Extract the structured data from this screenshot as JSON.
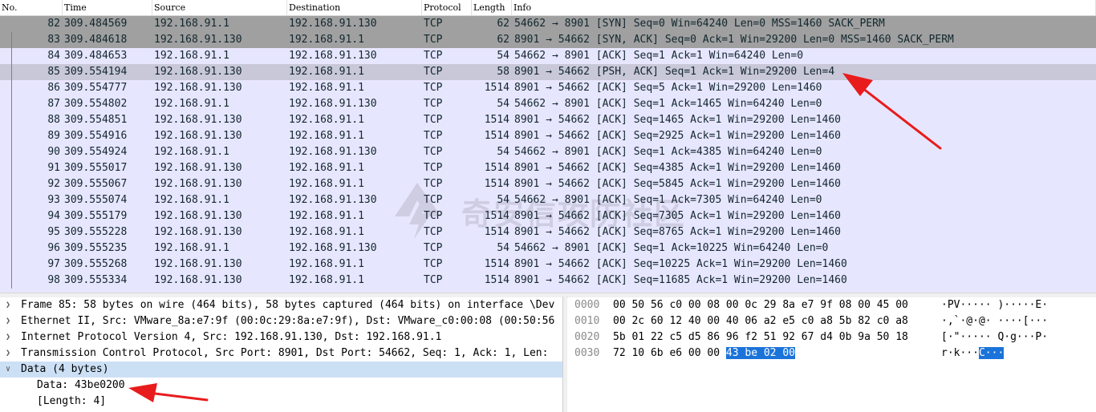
{
  "packet_list": {
    "columns": [
      "No.",
      "Time",
      "Source",
      "Destination",
      "Protocol",
      "Length",
      "Info"
    ],
    "rows": [
      {
        "no": "82",
        "time": "309.484569",
        "source": "192.168.91.1",
        "destination": "192.168.91.130",
        "protocol": "TCP",
        "length": "62",
        "info": "54662 → 8901 [SYN] Seq=0 Win=64240 Len=0 MSS=1460 SACK_PERM"
      },
      {
        "no": "83",
        "time": "309.484618",
        "source": "192.168.91.130",
        "destination": "192.168.91.1",
        "protocol": "TCP",
        "length": "62",
        "info": "8901 → 54662 [SYN, ACK] Seq=0 Ack=1 Win=29200 Len=0 MSS=1460 SACK_PERM"
      },
      {
        "no": "84",
        "time": "309.484653",
        "source": "192.168.91.1",
        "destination": "192.168.91.130",
        "protocol": "TCP",
        "length": "54",
        "info": "54662 → 8901 [ACK] Seq=1 Ack=1 Win=64240 Len=0"
      },
      {
        "no": "85",
        "time": "309.554194",
        "source": "192.168.91.130",
        "destination": "192.168.91.1",
        "protocol": "TCP",
        "length": "58",
        "info": "8901 → 54662 [PSH, ACK] Seq=1 Ack=1 Win=29200 Len=4"
      },
      {
        "no": "86",
        "time": "309.554777",
        "source": "192.168.91.130",
        "destination": "192.168.91.1",
        "protocol": "TCP",
        "length": "1514",
        "info": "8901 → 54662 [ACK] Seq=5 Ack=1 Win=29200 Len=1460"
      },
      {
        "no": "87",
        "time": "309.554802",
        "source": "192.168.91.1",
        "destination": "192.168.91.130",
        "protocol": "TCP",
        "length": "54",
        "info": "54662 → 8901 [ACK] Seq=1 Ack=1465 Win=64240 Len=0"
      },
      {
        "no": "88",
        "time": "309.554851",
        "source": "192.168.91.130",
        "destination": "192.168.91.1",
        "protocol": "TCP",
        "length": "1514",
        "info": "8901 → 54662 [ACK] Seq=1465 Ack=1 Win=29200 Len=1460"
      },
      {
        "no": "89",
        "time": "309.554916",
        "source": "192.168.91.130",
        "destination": "192.168.91.1",
        "protocol": "TCP",
        "length": "1514",
        "info": "8901 → 54662 [ACK] Seq=2925 Ack=1 Win=29200 Len=1460"
      },
      {
        "no": "90",
        "time": "309.554924",
        "source": "192.168.91.1",
        "destination": "192.168.91.130",
        "protocol": "TCP",
        "length": "54",
        "info": "54662 → 8901 [ACK] Seq=1 Ack=4385 Win=64240 Len=0"
      },
      {
        "no": "91",
        "time": "309.555017",
        "source": "192.168.91.130",
        "destination": "192.168.91.1",
        "protocol": "TCP",
        "length": "1514",
        "info": "8901 → 54662 [ACK] Seq=4385 Ack=1 Win=29200 Len=1460"
      },
      {
        "no": "92",
        "time": "309.555067",
        "source": "192.168.91.130",
        "destination": "192.168.91.1",
        "protocol": "TCP",
        "length": "1514",
        "info": "8901 → 54662 [ACK] Seq=5845 Ack=1 Win=29200 Len=1460"
      },
      {
        "no": "93",
        "time": "309.555074",
        "source": "192.168.91.1",
        "destination": "192.168.91.130",
        "protocol": "TCP",
        "length": "54",
        "info": "54662 → 8901 [ACK] Seq=1 Ack=7305 Win=64240 Len=0"
      },
      {
        "no": "94",
        "time": "309.555179",
        "source": "192.168.91.130",
        "destination": "192.168.91.1",
        "protocol": "TCP",
        "length": "1514",
        "info": "8901 → 54662 [ACK] Seq=7305 Ack=1 Win=29200 Len=1460"
      },
      {
        "no": "95",
        "time": "309.555228",
        "source": "192.168.91.130",
        "destination": "192.168.91.1",
        "protocol": "TCP",
        "length": "1514",
        "info": "8901 → 54662 [ACK] Seq=8765 Ack=1 Win=29200 Len=1460"
      },
      {
        "no": "96",
        "time": "309.555235",
        "source": "192.168.91.1",
        "destination": "192.168.91.130",
        "protocol": "TCP",
        "length": "54",
        "info": "54662 → 8901 [ACK] Seq=1 Ack=10225 Win=64240 Len=0"
      },
      {
        "no": "97",
        "time": "309.555268",
        "source": "192.168.91.130",
        "destination": "192.168.91.1",
        "protocol": "TCP",
        "length": "1514",
        "info": "8901 → 54662 [ACK] Seq=10225 Ack=1 Win=29200 Len=1460"
      },
      {
        "no": "98",
        "time": "309.555334",
        "source": "192.168.91.130",
        "destination": "192.168.91.1",
        "protocol": "TCP",
        "length": "1514",
        "info": "8901 → 54662 [ACK] Seq=11685 Ack=1 Win=29200 Len=1460"
      }
    ]
  },
  "details": {
    "lines": [
      {
        "expanded": false,
        "text": "Frame 85: 58 bytes on wire (464 bits), 58 bytes captured (464 bits) on interface \\Dev"
      },
      {
        "expanded": false,
        "text": "Ethernet II, Src: VMware_8a:e7:9f (00:0c:29:8a:e7:9f), Dst: VMware_c0:00:08 (00:50:56"
      },
      {
        "expanded": false,
        "text": "Internet Protocol Version 4, Src: 192.168.91.130, Dst: 192.168.91.1"
      },
      {
        "expanded": false,
        "text": "Transmission Control Protocol, Src Port: 8901, Dst Port: 54662, Seq: 1, Ack: 1, Len:"
      },
      {
        "expanded": true,
        "text": "Data (4 bytes)"
      }
    ],
    "children": [
      "Data: 43be0200",
      "[Length: 4]"
    ]
  },
  "bytes": {
    "rows": [
      {
        "offset": "0000",
        "hex": "00 50 56 c0 00 08 00 0c  29 8a e7 9f 08 00 45 00",
        "ascii": "·PV·····  )·····E·"
      },
      {
        "offset": "0010",
        "hex": "00 2c 60 12 40 00 40 06  a2 e5 c0 a8 5b 82 c0 a8",
        "ascii": "·,`·@·@·  ····[···"
      },
      {
        "offset": "0020",
        "hex": "5b 01 22 c5 d5 86 96 f2  51 92 67 d4 0b 9a 50 18",
        "ascii": "[·\"·····  Q·g···P·"
      },
      {
        "offset": "0030",
        "hex_plain": "72 10 6b e6 00 00 ",
        "hex_highlight": "43 be  02 00",
        "ascii_plain": "r·k···",
        "ascii_highlight": "C···"
      }
    ]
  },
  "watermark": {
    "text": "奇安信攻防社区"
  },
  "colors": {
    "tcp_row": "#e7e6ff",
    "syn_row": "#a0a0a0",
    "selected_row": "#c9c8d8",
    "byte_highlight": "#1a73d9",
    "annotation": "#e81c1c"
  }
}
